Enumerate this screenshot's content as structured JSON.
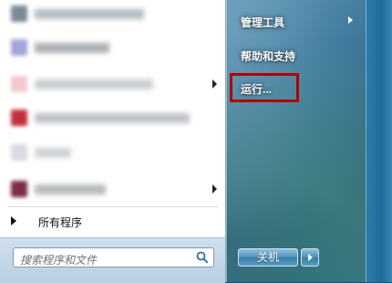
{
  "left": {
    "all_programs_label": "所有程序",
    "search_placeholder": "搜索程序和文件"
  },
  "right": {
    "items": [
      {
        "label": "管理工具"
      },
      {
        "label": "帮助和支持"
      },
      {
        "label": "运行..."
      }
    ],
    "shutdown_label": "关机"
  },
  "colors": {
    "highlight_border": "#b30000",
    "pane_background": "#ffffff"
  }
}
